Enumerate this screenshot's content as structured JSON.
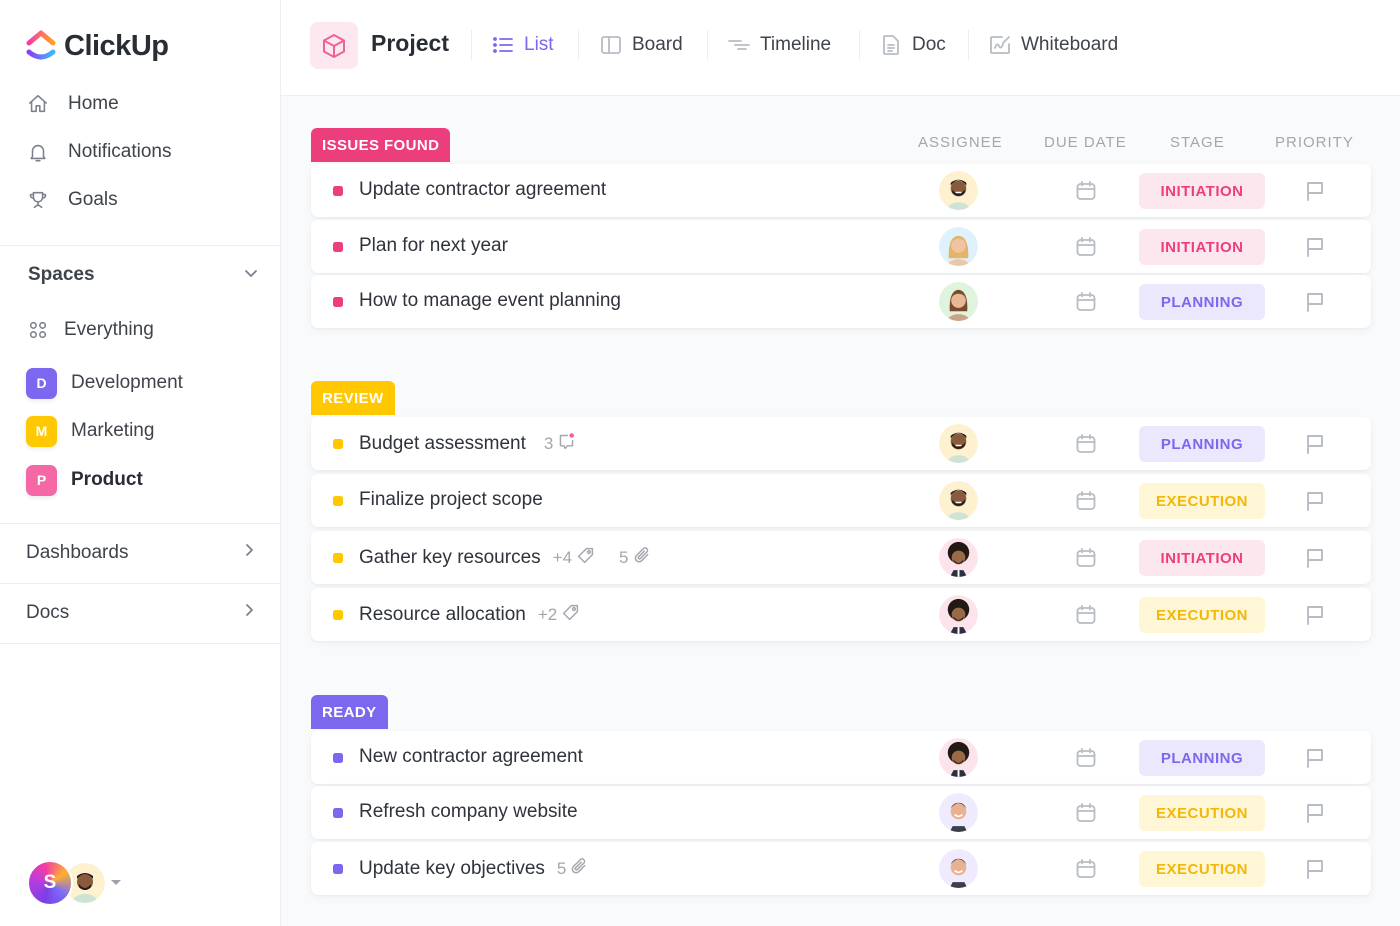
{
  "app": {
    "name": "ClickUp"
  },
  "sidebar": {
    "nav": [
      {
        "label": "Home",
        "icon": "home-icon"
      },
      {
        "label": "Notifications",
        "icon": "bell-icon"
      },
      {
        "label": "Goals",
        "icon": "trophy-icon"
      }
    ],
    "spaces_label": "Spaces",
    "everything_label": "Everything",
    "spaces": [
      {
        "initial": "D",
        "label": "Development",
        "color": "#7b68ee"
      },
      {
        "initial": "M",
        "label": "Marketing",
        "color": "#ffc800"
      },
      {
        "initial": "P",
        "label": "Product",
        "color": "#f667a5",
        "active": true
      }
    ],
    "sections": [
      {
        "label": "Dashboards"
      },
      {
        "label": "Docs"
      }
    ],
    "user": {
      "initial": "S"
    }
  },
  "topbar": {
    "title": "Project",
    "views": [
      {
        "label": "List",
        "icon": "list-icon",
        "active": true
      },
      {
        "label": "Board",
        "icon": "board-icon"
      },
      {
        "label": "Timeline",
        "icon": "timeline-icon"
      },
      {
        "label": "Doc",
        "icon": "doc-icon"
      },
      {
        "label": "Whiteboard",
        "icon": "whiteboard-icon"
      }
    ]
  },
  "columns": {
    "assignee": "ASSIGNEE",
    "due_date": "DUE DATE",
    "stage": "STAGE",
    "priority": "PRIORITY"
  },
  "colors": {
    "issues": "#ec3d7d",
    "review": "#ffc800",
    "ready": "#7b68ee",
    "accent": "#7b68ee"
  },
  "groups": [
    {
      "label": "ISSUES FOUND",
      "color": "#ec3d7d",
      "tasks": [
        {
          "name": "Update contractor agreement",
          "assignee": "man-beard",
          "stage": "INITIATION"
        },
        {
          "name": "Plan for next year",
          "assignee": "woman-blonde",
          "stage": "INITIATION"
        },
        {
          "name": "How to manage event planning",
          "assignee": "woman-brown",
          "stage": "PLANNING"
        }
      ]
    },
    {
      "label": "REVIEW",
      "color": "#ffc800",
      "tasks": [
        {
          "name": "Budget assessment",
          "assignee": "man-beard",
          "stage": "PLANNING",
          "comments": "3"
        },
        {
          "name": "Finalize project scope",
          "assignee": "man-beard",
          "stage": "EXECUTION"
        },
        {
          "name": "Gather key resources",
          "assignee": "man-afro",
          "stage": "INITIATION",
          "tags": "+4",
          "attachments": "5"
        },
        {
          "name": "Resource allocation",
          "assignee": "man-afro",
          "stage": "EXECUTION",
          "tags": "+2"
        }
      ]
    },
    {
      "label": "READY",
      "color": "#7b68ee",
      "tasks": [
        {
          "name": "New contractor agreement",
          "assignee": "man-afro",
          "stage": "PLANNING"
        },
        {
          "name": "Refresh company website",
          "assignee": "man-smile",
          "stage": "EXECUTION"
        },
        {
          "name": "Update key objectives",
          "assignee": "man-smile",
          "stage": "EXECUTION",
          "attachments": "5"
        }
      ]
    }
  ]
}
